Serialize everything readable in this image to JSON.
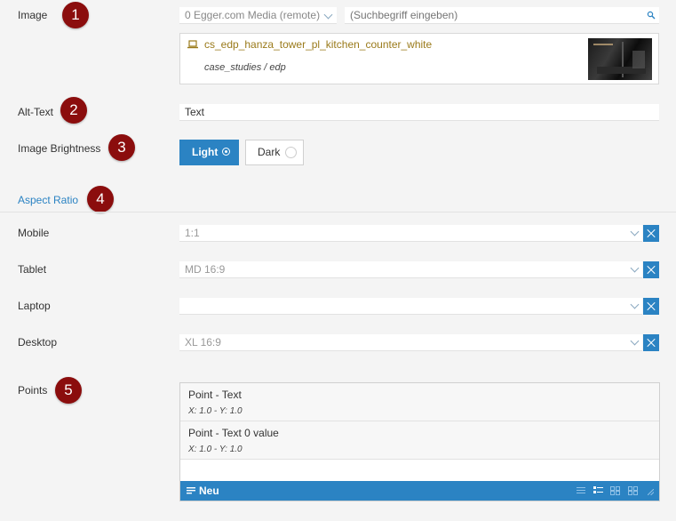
{
  "image": {
    "label": "Image",
    "badge": "1",
    "source_select": "0 Egger.com Media (remote)",
    "search_placeholder": "(Suchbegriff eingeben)",
    "file_name": "cs_edp_hanza_tower_pl_kitchen_counter_white",
    "file_path": "case_studies / edp"
  },
  "alt_text": {
    "label": "Alt-Text",
    "badge": "2",
    "value": "Text"
  },
  "brightness": {
    "label": "Image Brightness",
    "badge": "3",
    "options": [
      "Light",
      "Dark"
    ],
    "selected": "Light"
  },
  "aspect_ratio": {
    "title": "Aspect Ratio",
    "badge": "4",
    "rows": [
      {
        "label": "Mobile",
        "value": "1:1"
      },
      {
        "label": "Tablet",
        "value": "MD 16:9"
      },
      {
        "label": "Laptop",
        "value": ""
      },
      {
        "label": "Desktop",
        "value": "XL 16:9"
      }
    ]
  },
  "points": {
    "label": "Points",
    "badge": "5",
    "items": [
      {
        "title": "Point - Text",
        "coords": "X: 1.0 - Y: 1.0"
      },
      {
        "title": "Point - Text 0 value",
        "coords": "X: 1.0 - Y: 1.0"
      }
    ],
    "new_label": "Neu"
  },
  "colors": {
    "accent": "#2b83c3",
    "badge": "#8b0d0d",
    "file_link": "#9a7a1a"
  }
}
